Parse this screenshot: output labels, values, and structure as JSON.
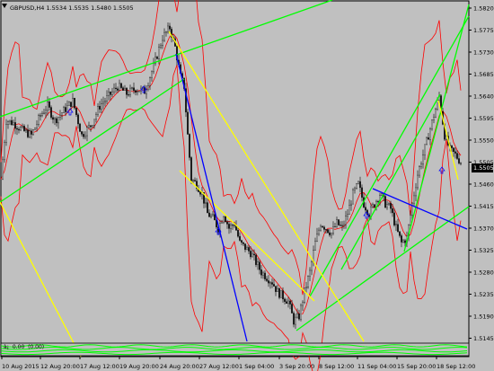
{
  "window": {
    "symbol_label": "GBPUSD,H4  1.5534 1.5535 1.5480 1.5505",
    "indicator_label": "à¡  0.00  (0.00)",
    "current_price": "1.5505"
  },
  "colors": {
    "background": "#c0c0c0",
    "candle": "#000000",
    "bollinger": "#ff0000",
    "trendline_green": "#00ff00",
    "trendline_yellow": "#ffff00",
    "trendline_blue": "#0000ff",
    "arrow": "#0000ff"
  },
  "chart_data": {
    "type": "candlestick",
    "symbol": "GBPUSD",
    "timeframe": "H4",
    "ylim": [
      1.5145,
      1.5832
    ],
    "price_axis_ticks": [
      "1.5820",
      "1.5775",
      "1.5730",
      "1.5685",
      "1.5640",
      "1.5595",
      "1.5550",
      "1.5505",
      "1.5460",
      "1.5415",
      "1.5370",
      "1.5325",
      "1.5280",
      "1.5235",
      "1.5190",
      "1.5145"
    ],
    "time_axis_ticks": [
      "10 Aug 2015",
      "12 Aug 20:00",
      "17 Aug 12:00",
      "19 Aug 20:00",
      "24 Aug 20:00",
      "27 Aug 12:00",
      "1 Sep 04:00",
      "3 Sep 20:00",
      "8 Sep 12:00",
      "11 Sep 04:00",
      "15 Sep 20:00",
      "18 Sep 12:00"
    ],
    "last_price": 1.5505,
    "close_path": [
      [
        0,
        1.547
      ],
      [
        6,
        1.559
      ],
      [
        14,
        1.5585
      ],
      [
        24,
        1.557
      ],
      [
        34,
        1.556
      ],
      [
        44,
        1.56
      ],
      [
        52,
        1.562
      ],
      [
        60,
        1.559
      ],
      [
        70,
        1.561
      ],
      [
        80,
        1.563
      ],
      [
        90,
        1.556
      ],
      [
        100,
        1.558
      ],
      [
        110,
        1.562
      ],
      [
        120,
        1.564
      ],
      [
        130,
        1.566
      ],
      [
        140,
        1.5645
      ],
      [
        150,
        1.5655
      ],
      [
        160,
        1.565
      ],
      [
        170,
        1.57
      ],
      [
        180,
        1.576
      ],
      [
        188,
        1.578
      ],
      [
        194,
        1.574
      ],
      [
        200,
        1.568
      ],
      [
        204,
        1.566
      ],
      [
        208,
        1.556
      ],
      [
        212,
        1.547
      ],
      [
        218,
        1.546
      ],
      [
        224,
        1.544
      ],
      [
        230,
        1.54
      ],
      [
        236,
        1.539
      ],
      [
        242,
        1.537
      ],
      [
        248,
        1.54
      ],
      [
        254,
        1.537
      ],
      [
        260,
        1.538
      ],
      [
        266,
        1.534
      ],
      [
        272,
        1.533
      ],
      [
        278,
        1.532
      ],
      [
        284,
        1.53
      ],
      [
        290,
        1.528
      ],
      [
        296,
        1.527
      ],
      [
        302,
        1.526
      ],
      [
        308,
        1.524
      ],
      [
        314,
        1.523
      ],
      [
        320,
        1.522
      ],
      [
        326,
        1.518
      ],
      [
        332,
        1.519
      ],
      [
        338,
        1.524
      ],
      [
        344,
        1.528
      ],
      [
        350,
        1.534
      ],
      [
        356,
        1.538
      ],
      [
        362,
        1.537
      ],
      [
        368,
        1.536
      ],
      [
        374,
        1.538
      ],
      [
        380,
        1.537
      ],
      [
        386,
        1.54
      ],
      [
        392,
        1.544
      ],
      [
        398,
        1.546
      ],
      [
        404,
        1.542
      ],
      [
        410,
        1.54
      ],
      [
        416,
        1.542
      ],
      [
        422,
        1.544
      ],
      [
        428,
        1.542
      ],
      [
        434,
        1.541
      ],
      [
        440,
        1.537
      ],
      [
        446,
        1.534
      ],
      [
        452,
        1.535
      ],
      [
        458,
        1.542
      ],
      [
        464,
        1.548
      ],
      [
        470,
        1.552
      ],
      [
        476,
        1.556
      ],
      [
        482,
        1.56
      ],
      [
        488,
        1.564
      ],
      [
        494,
        1.556
      ],
      [
        500,
        1.553
      ],
      [
        506,
        1.552
      ],
      [
        512,
        1.5505
      ]
    ]
  }
}
